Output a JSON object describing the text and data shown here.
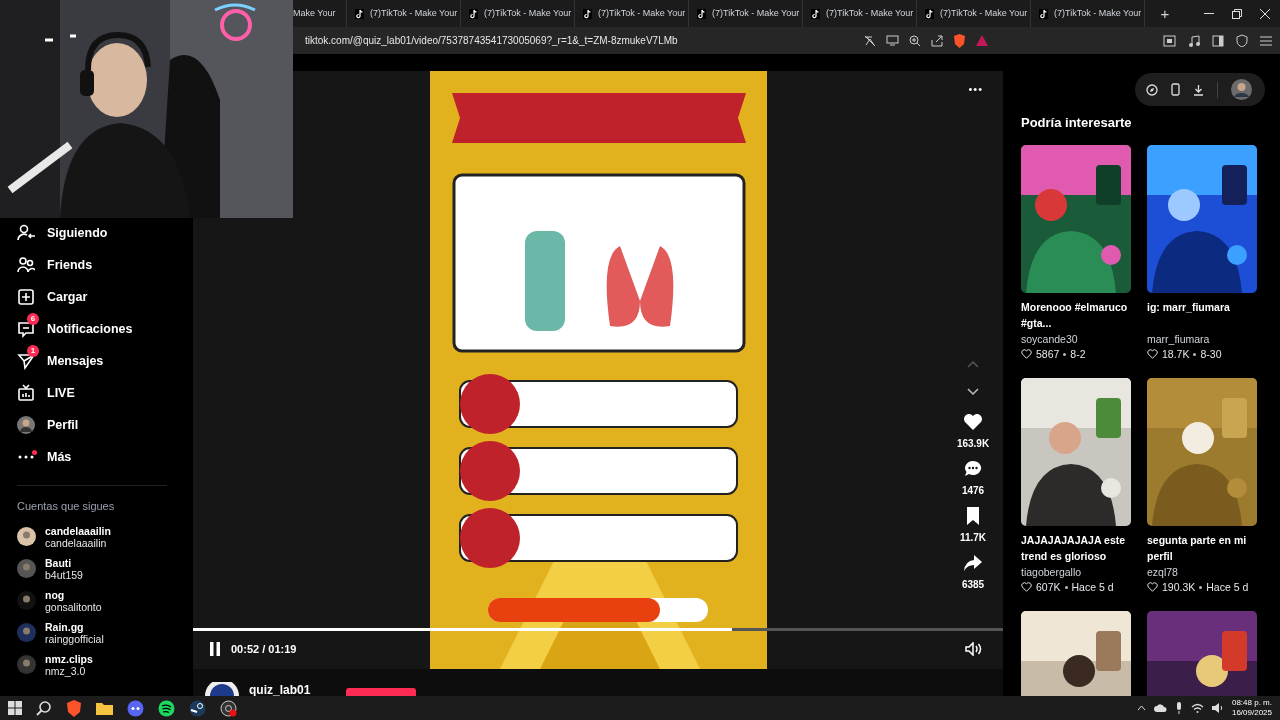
{
  "browser": {
    "tabs": [
      {
        "title": "Make Your"
      },
      {
        "title": "(7)TikTok - Make Your"
      },
      {
        "title": "(7)TikTok - Make Your"
      },
      {
        "title": "(7)TikTok - Make Your"
      },
      {
        "title": "(7)TikTok - Make Your"
      },
      {
        "title": "(7)TikTok - Make Your"
      },
      {
        "title": "(7)TikTok - Make Your"
      },
      {
        "title": "(7)TikTok - Make Your"
      }
    ],
    "new_tab": "+",
    "url": "tiktok.com/@quiz_lab01/video/7537874354173005069?_r=1&_t=ZM-8zmukeV7LMb"
  },
  "sidebar": {
    "nav": [
      {
        "label": "Siguiendo",
        "dot": false
      },
      {
        "label": "Friends",
        "dot": false
      },
      {
        "label": "Cargar",
        "dot": false
      },
      {
        "label": "Notificaciones",
        "badge": "6",
        "dot": false
      },
      {
        "label": "Mensajes",
        "badge": "1",
        "dot": false
      },
      {
        "label": "LIVE",
        "dot": false
      },
      {
        "label": "Perfil",
        "dot": false
      },
      {
        "label": "Más",
        "dot": true
      }
    ],
    "following_heading": "Cuentas que sigues",
    "following": [
      {
        "name": "candelaaailin",
        "handle": "candelaaailin"
      },
      {
        "name": "Bauti",
        "handle": "b4ut159"
      },
      {
        "name": "nog",
        "handle": "gonsalitonto"
      },
      {
        "name": "Rain.gg",
        "handle": "rainggofficial"
      },
      {
        "name": "nmz.clips",
        "handle": "nmz_3.0"
      }
    ]
  },
  "player": {
    "more": "•••",
    "progress": {
      "level": 0.665
    },
    "playing": true,
    "time": "00:52 / 01:19",
    "actions": [
      {
        "count": "163.9K"
      },
      {
        "count": "1476"
      },
      {
        "count": "11.7K"
      },
      {
        "count": "6385"
      }
    ],
    "author": "quiz_lab01"
  },
  "suggestions": {
    "title": "Podría interesarte",
    "cards": [
      {
        "kind": "video",
        "title": "Morenooo #elmaruco #gta...",
        "author": "soycande30",
        "likes": "5867",
        "date": "8-2"
      },
      {
        "kind": "video",
        "title": "ig: marr_fiumara",
        "author": "marr_fiumara",
        "likes": "18.7K",
        "date": "8-30"
      },
      {
        "kind": "video",
        "title": "JAJAJAJAJAJA este trend es glorioso",
        "author": "tiagobergallo",
        "likes": "607K",
        "date": "Hace 5 d"
      },
      {
        "kind": "video",
        "title": "segunta parte en mi perfil",
        "author": "ezql78",
        "likes": "190.3K",
        "date": "Hace 5 d"
      },
      {
        "kind": "picture"
      },
      {
        "kind": "picture"
      }
    ]
  },
  "taskbar": {
    "time": "08:48 p. m.",
    "date": "16/09/2025"
  }
}
